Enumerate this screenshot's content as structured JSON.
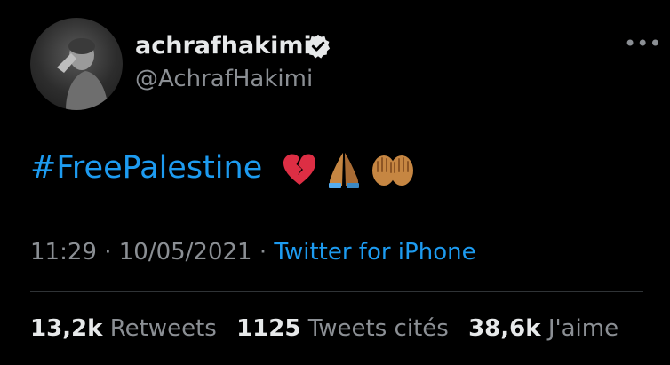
{
  "author": {
    "display_name": "achrafhakimi",
    "handle": "@AchrafHakimi",
    "verified": true
  },
  "tweet": {
    "hashtag": "#FreePalestine",
    "emojis": [
      "broken-heart",
      "folded-hands",
      "palms-up-together"
    ]
  },
  "meta": {
    "time": "11:29",
    "separator": "·",
    "date": "10/05/2021",
    "source": "Twitter for iPhone"
  },
  "stats": {
    "retweets_count": "13,2k",
    "retweets_label": "Retweets",
    "quotes_count": "1125",
    "quotes_label": "Tweets cités",
    "likes_count": "38,6k",
    "likes_label": "J'aime"
  },
  "colors": {
    "background": "#000000",
    "link": "#1d9bf0",
    "secondary_text": "#8b8f94",
    "primary_text": "#e7e9ea"
  }
}
